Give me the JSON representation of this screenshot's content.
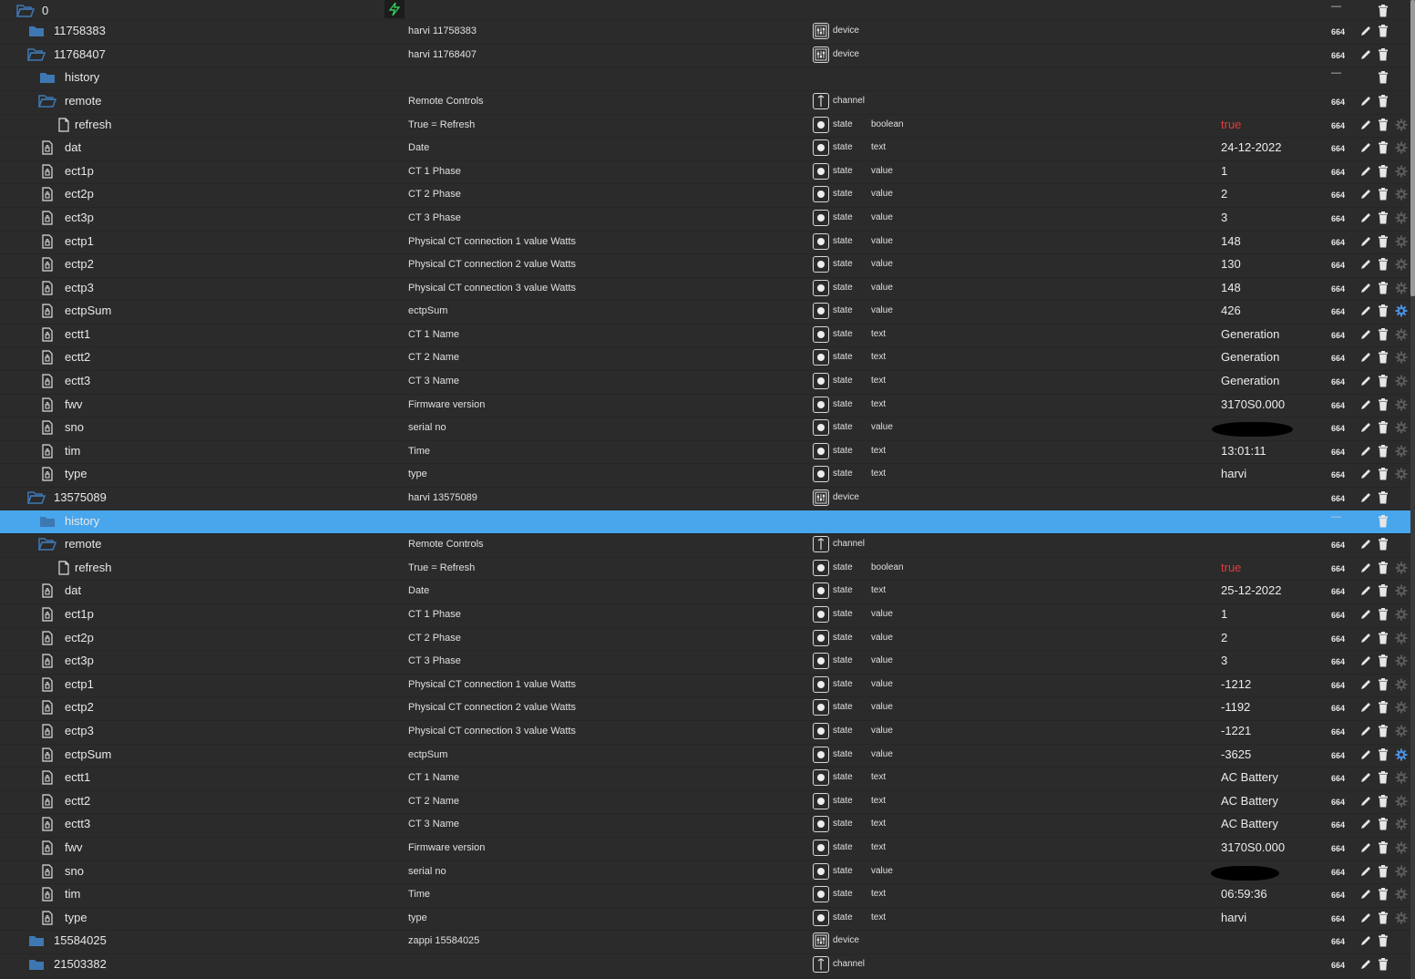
{
  "colors": {
    "background": "#2b2b2b",
    "selected_row": "#48a6ec",
    "folder_icon": "#3e78b3",
    "boolean_value": "#e33a3a",
    "logo_accent": "#34c759"
  },
  "icons": {
    "folder_open": "folder-open-icon",
    "folder_closed": "folder-icon",
    "file": "file-icon",
    "state_file": "state-file-icon",
    "device": "device-icon",
    "channel": "channel-icon",
    "state": "state-icon",
    "edit": "pencil-icon",
    "delete": "trash-icon",
    "custom": "gear-icon"
  },
  "rows": [
    {
      "name": "0",
      "level": 0,
      "kind": "folder-open",
      "acl": "",
      "minus": true
    },
    {
      "name": "11758383",
      "level": 1,
      "kind": "folder",
      "desc": "harvi 11758383",
      "type": "device",
      "acl": "664"
    },
    {
      "name": "11768407",
      "level": 1,
      "kind": "folder-open",
      "desc": "harvi 11768407",
      "type": "device",
      "acl": "664"
    },
    {
      "name": "history",
      "level": 2,
      "kind": "folder",
      "minus": true
    },
    {
      "name": "remote",
      "level": 2,
      "kind": "folder-open",
      "desc": "Remote Controls",
      "type": "channel",
      "acl": "664"
    },
    {
      "name": "refresh",
      "level": 3,
      "kind": "file",
      "desc": "True = Refresh",
      "type": "state",
      "role": "boolean",
      "value": "true",
      "bool": true,
      "acl": "664",
      "gear": true
    },
    {
      "name": "dat",
      "level": 2,
      "kind": "state-file",
      "desc": "Date",
      "type": "state",
      "role": "text",
      "value": "24-12-2022",
      "acl": "664",
      "gear": true
    },
    {
      "name": "ect1p",
      "level": 2,
      "kind": "state-file",
      "desc": "CT 1 Phase",
      "type": "state",
      "role": "value",
      "value": "1",
      "acl": "664",
      "gear": true
    },
    {
      "name": "ect2p",
      "level": 2,
      "kind": "state-file",
      "desc": "CT 2 Phase",
      "type": "state",
      "role": "value",
      "value": "2",
      "acl": "664",
      "gear": true
    },
    {
      "name": "ect3p",
      "level": 2,
      "kind": "state-file",
      "desc": "CT 3 Phase",
      "type": "state",
      "role": "value",
      "value": "3",
      "acl": "664",
      "gear": true
    },
    {
      "name": "ectp1",
      "level": 2,
      "kind": "state-file",
      "desc": "Physical CT connection 1 value Watts",
      "type": "state",
      "role": "value",
      "value": "148",
      "acl": "664",
      "gear": true
    },
    {
      "name": "ectp2",
      "level": 2,
      "kind": "state-file",
      "desc": "Physical CT connection 2 value Watts",
      "type": "state",
      "role": "value",
      "value": "130",
      "acl": "664",
      "gear": true
    },
    {
      "name": "ectp3",
      "level": 2,
      "kind": "state-file",
      "desc": "Physical CT connection 3 value Watts",
      "type": "state",
      "role": "value",
      "value": "148",
      "acl": "664",
      "gear": true
    },
    {
      "name": "ectpSum",
      "level": 2,
      "kind": "state-file",
      "desc": "ectpSum",
      "type": "state",
      "role": "value",
      "value": "426",
      "acl": "664",
      "gear": true,
      "gearActive": true
    },
    {
      "name": "ectt1",
      "level": 2,
      "kind": "state-file",
      "desc": "CT 1 Name",
      "type": "state",
      "role": "text",
      "value": "Generation",
      "acl": "664",
      "gear": true
    },
    {
      "name": "ectt2",
      "level": 2,
      "kind": "state-file",
      "desc": "CT 2 Name",
      "type": "state",
      "role": "text",
      "value": "Generation",
      "acl": "664",
      "gear": true
    },
    {
      "name": "ectt3",
      "level": 2,
      "kind": "state-file",
      "desc": "CT 3 Name",
      "type": "state",
      "role": "text",
      "value": "Generation",
      "acl": "664",
      "gear": true
    },
    {
      "name": "fwv",
      "level": 2,
      "kind": "state-file",
      "desc": "Firmware version",
      "type": "state",
      "role": "text",
      "value": "3170S0.000",
      "acl": "664",
      "gear": true
    },
    {
      "name": "sno",
      "level": 2,
      "kind": "state-file",
      "desc": "serial no",
      "type": "state",
      "role": "value",
      "redacted": true,
      "acl": "664",
      "gear": true
    },
    {
      "name": "tim",
      "level": 2,
      "kind": "state-file",
      "desc": "Time",
      "type": "state",
      "role": "text",
      "value": "13:01:11",
      "acl": "664",
      "gear": true
    },
    {
      "name": "type",
      "level": 2,
      "kind": "state-file",
      "desc": "type",
      "type": "state",
      "role": "text",
      "value": "harvi",
      "acl": "664",
      "gear": true
    },
    {
      "name": "13575089",
      "level": 1,
      "kind": "folder-open",
      "desc": "harvi 13575089",
      "type": "device",
      "acl": "664"
    },
    {
      "name": "history",
      "level": 2,
      "kind": "folder",
      "minus": true,
      "selected": true
    },
    {
      "name": "remote",
      "level": 2,
      "kind": "folder-open",
      "desc": "Remote Controls",
      "type": "channel",
      "acl": "664"
    },
    {
      "name": "refresh",
      "level": 3,
      "kind": "file",
      "desc": "True = Refresh",
      "type": "state",
      "role": "boolean",
      "value": "true",
      "bool": true,
      "acl": "664",
      "gear": true
    },
    {
      "name": "dat",
      "level": 2,
      "kind": "state-file",
      "desc": "Date",
      "type": "state",
      "role": "text",
      "value": "25-12-2022",
      "acl": "664",
      "gear": true
    },
    {
      "name": "ect1p",
      "level": 2,
      "kind": "state-file",
      "desc": "CT 1 Phase",
      "type": "state",
      "role": "value",
      "value": "1",
      "acl": "664",
      "gear": true
    },
    {
      "name": "ect2p",
      "level": 2,
      "kind": "state-file",
      "desc": "CT 2 Phase",
      "type": "state",
      "role": "value",
      "value": "2",
      "acl": "664",
      "gear": true
    },
    {
      "name": "ect3p",
      "level": 2,
      "kind": "state-file",
      "desc": "CT 3 Phase",
      "type": "state",
      "role": "value",
      "value": "3",
      "acl": "664",
      "gear": true
    },
    {
      "name": "ectp1",
      "level": 2,
      "kind": "state-file",
      "desc": "Physical CT connection 1 value Watts",
      "type": "state",
      "role": "value",
      "value": "-1212",
      "acl": "664",
      "gear": true
    },
    {
      "name": "ectp2",
      "level": 2,
      "kind": "state-file",
      "desc": "Physical CT connection 2 value Watts",
      "type": "state",
      "role": "value",
      "value": "-1192",
      "acl": "664",
      "gear": true
    },
    {
      "name": "ectp3",
      "level": 2,
      "kind": "state-file",
      "desc": "Physical CT connection 3 value Watts",
      "type": "state",
      "role": "value",
      "value": "-1221",
      "acl": "664",
      "gear": true
    },
    {
      "name": "ectpSum",
      "level": 2,
      "kind": "state-file",
      "desc": "ectpSum",
      "type": "state",
      "role": "value",
      "value": "-3625",
      "acl": "664",
      "gear": true,
      "gearActive": true
    },
    {
      "name": "ectt1",
      "level": 2,
      "kind": "state-file",
      "desc": "CT 1 Name",
      "type": "state",
      "role": "text",
      "value": "AC Battery",
      "acl": "664",
      "gear": true
    },
    {
      "name": "ectt2",
      "level": 2,
      "kind": "state-file",
      "desc": "CT 2 Name",
      "type": "state",
      "role": "text",
      "value": "AC Battery",
      "acl": "664",
      "gear": true
    },
    {
      "name": "ectt3",
      "level": 2,
      "kind": "state-file",
      "desc": "CT 3 Name",
      "type": "state",
      "role": "text",
      "value": "AC Battery",
      "acl": "664",
      "gear": true
    },
    {
      "name": "fwv",
      "level": 2,
      "kind": "state-file",
      "desc": "Firmware version",
      "type": "state",
      "role": "text",
      "value": "3170S0.000",
      "acl": "664",
      "gear": true
    },
    {
      "name": "sno",
      "level": 2,
      "kind": "state-file",
      "desc": "serial no",
      "type": "state",
      "role": "value",
      "redacted": true,
      "acl": "664",
      "gear": true
    },
    {
      "name": "tim",
      "level": 2,
      "kind": "state-file",
      "desc": "Time",
      "type": "state",
      "role": "text",
      "value": "06:59:36",
      "acl": "664",
      "gear": true
    },
    {
      "name": "type",
      "level": 2,
      "kind": "state-file",
      "desc": "type",
      "type": "state",
      "role": "text",
      "value": "harvi",
      "acl": "664",
      "gear": true
    },
    {
      "name": "15584025",
      "level": 1,
      "kind": "folder",
      "desc": "zappi 15584025",
      "type": "device",
      "acl": "664"
    },
    {
      "name": "21503382",
      "level": 1,
      "kind": "folder",
      "desc": "",
      "type": "channel",
      "acl": "664"
    }
  ],
  "minus_glyph": "—"
}
